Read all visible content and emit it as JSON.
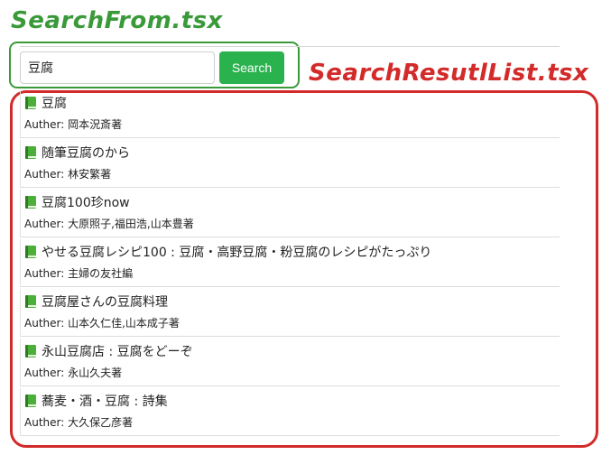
{
  "annotations": {
    "search_component": "SearchFrom.tsx",
    "result_component": "SearchResutlList.tsx",
    "search_color": "#3a9a3a",
    "result_color": "#d32a2a"
  },
  "search": {
    "value": "豆腐",
    "button_label": "Search",
    "button_color": "#2ab24e"
  },
  "results": [
    {
      "icon": "book-icon",
      "title": "豆腐",
      "author_label": "Auther: ",
      "author": "岡本況斎著"
    },
    {
      "icon": "book-icon",
      "title": "随筆豆腐のから",
      "author_label": "Auther: ",
      "author": "林安繁著"
    },
    {
      "icon": "book-icon",
      "title": "豆腐100珍now",
      "author_label": "Auther: ",
      "author": "大原照子,福田浩,山本豊著"
    },
    {
      "icon": "book-icon",
      "title": "やせる豆腐レシピ100 : 豆腐・高野豆腐・粉豆腐のレシピがたっぷり",
      "author_label": "Auther: ",
      "author": "主婦の友社編"
    },
    {
      "icon": "book-icon",
      "title": "豆腐屋さんの豆腐料理",
      "author_label": "Auther: ",
      "author": "山本久仁佳,山本成子著"
    },
    {
      "icon": "book-icon",
      "title": "永山豆腐店 : 豆腐をどーぞ",
      "author_label": "Auther: ",
      "author": "永山久夫著"
    },
    {
      "icon": "book-icon",
      "title": "蕎麦・酒・豆腐 : 詩集",
      "author_label": "Auther: ",
      "author": "大久保乙彦著"
    }
  ]
}
